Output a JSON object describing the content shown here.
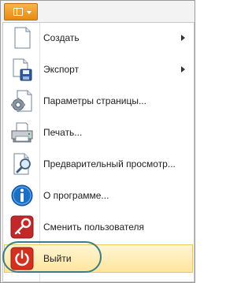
{
  "app_menu": {
    "button_icon": "document-menu-icon",
    "caret_icon": "chevron-down-icon",
    "items": [
      {
        "label": "Создать",
        "icon": "new-document-icon",
        "submenu": true
      },
      {
        "label": "Экспорт",
        "icon": "export-save-icon",
        "submenu": true
      },
      {
        "label": "Параметры страницы...",
        "icon": "page-setup-icon",
        "submenu": false
      },
      {
        "label": "Печать...",
        "icon": "printer-icon",
        "submenu": false
      },
      {
        "label": "Предварительный просмотр...",
        "icon": "print-preview-icon",
        "submenu": false
      },
      {
        "label": "О программе...",
        "icon": "info-icon",
        "submenu": false
      },
      {
        "label": "Сменить пользователя",
        "icon": "key-icon",
        "submenu": false
      },
      {
        "label": "Выйти",
        "icon": "power-icon",
        "submenu": false,
        "active": true
      }
    ]
  },
  "colors": {
    "app_button": "#e98a12",
    "highlight_ring": "#3b7e86",
    "active_item": "#ffe59a",
    "info_icon": "#1d6fc4",
    "key_icon": "#c0282a",
    "power_icon": "#d4301f"
  }
}
